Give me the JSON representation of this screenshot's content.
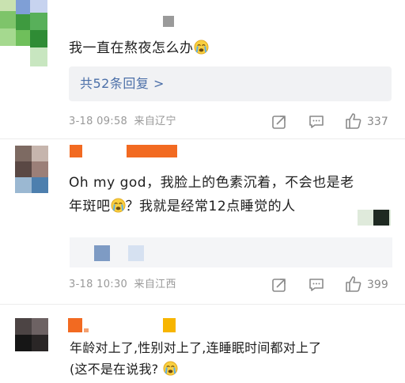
{
  "comment1": {
    "text": "我一直在熬夜怎么办",
    "emoji": "crying-face-icon",
    "replies_label": "共52条回复 >",
    "time": "3-18 09:58",
    "location": "来自辽宁",
    "likes": "337"
  },
  "comment2": {
    "line1": "Oh my god，我脸上的色素沉着，不会也是老",
    "line2a": "年斑吧",
    "line2b": "？我就是经常12点睡觉的人",
    "emoji": "crying-face-icon",
    "time": "3-18 10:30",
    "location": "来自江西",
    "likes": "399"
  },
  "comment3": {
    "line1": "年龄对上了,性别对上了,连睡眠时间都对上了",
    "line2": "(这不是在说我?",
    "emoji": "crying-face-icon"
  },
  "colors": {
    "link": "#4b6fa8",
    "meta": "#999999",
    "username_orange": "#f26a21",
    "username_gold": "#f7b500"
  }
}
